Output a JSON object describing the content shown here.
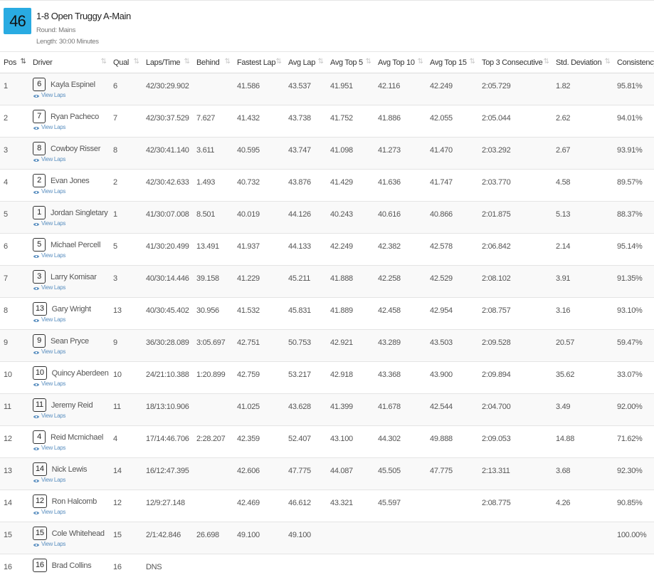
{
  "event": {
    "number": "46",
    "title": "1-8 Open Truggy A-Main",
    "round": "Round: Mains",
    "length": "Length: 30:00 Minutes"
  },
  "columns": [
    "Pos",
    "Driver",
    "Qual",
    "Laps/Time",
    "Behind",
    "Fastest Lap",
    "Avg Lap",
    "Avg Top 5",
    "Avg Top 10",
    "Avg Top 15",
    "Top 3 Consecutive",
    "Std. Deviation",
    "Consistency"
  ],
  "view_laps_label": "View Laps",
  "rows": [
    {
      "pos": "1",
      "car": "6",
      "driver": "Kayla Espinel",
      "qual": "6",
      "laps": "42/30:29.902",
      "behind": "",
      "fastest": "41.586",
      "avg": "43.537",
      "top5": "41.951",
      "top10": "42.116",
      "top15": "42.249",
      "top3c": "2:05.729",
      "std": "1.82",
      "cons": "95.81%",
      "view": true
    },
    {
      "pos": "2",
      "car": "7",
      "driver": "Ryan Pacheco",
      "qual": "7",
      "laps": "42/30:37.529",
      "behind": "7.627",
      "fastest": "41.432",
      "avg": "43.738",
      "top5": "41.752",
      "top10": "41.886",
      "top15": "42.055",
      "top3c": "2:05.044",
      "std": "2.62",
      "cons": "94.01%",
      "view": true
    },
    {
      "pos": "3",
      "car": "8",
      "driver": "Cowboy Risser",
      "qual": "8",
      "laps": "42/30:41.140",
      "behind": "3.611",
      "fastest": "40.595",
      "avg": "43.747",
      "top5": "41.098",
      "top10": "41.273",
      "top15": "41.470",
      "top3c": "2:03.292",
      "std": "2.67",
      "cons": "93.91%",
      "view": true
    },
    {
      "pos": "4",
      "car": "2",
      "driver": "Evan Jones",
      "qual": "2",
      "laps": "42/30:42.633",
      "behind": "1.493",
      "fastest": "40.732",
      "avg": "43.876",
      "top5": "41.429",
      "top10": "41.636",
      "top15": "41.747",
      "top3c": "2:03.770",
      "std": "4.58",
      "cons": "89.57%",
      "view": true
    },
    {
      "pos": "5",
      "car": "1",
      "driver": "Jordan Singletary",
      "qual": "1",
      "laps": "41/30:07.008",
      "behind": "8.501",
      "fastest": "40.019",
      "avg": "44.126",
      "top5": "40.243",
      "top10": "40.616",
      "top15": "40.866",
      "top3c": "2:01.875",
      "std": "5.13",
      "cons": "88.37%",
      "view": true
    },
    {
      "pos": "6",
      "car": "5",
      "driver": "Michael Percell",
      "qual": "5",
      "laps": "41/30:20.499",
      "behind": "13.491",
      "fastest": "41.937",
      "avg": "44.133",
      "top5": "42.249",
      "top10": "42.382",
      "top15": "42.578",
      "top3c": "2:06.842",
      "std": "2.14",
      "cons": "95.14%",
      "view": true
    },
    {
      "pos": "7",
      "car": "3",
      "driver": "Larry Komisar",
      "qual": "3",
      "laps": "40/30:14.446",
      "behind": "39.158",
      "fastest": "41.229",
      "avg": "45.211",
      "top5": "41.888",
      "top10": "42.258",
      "top15": "42.529",
      "top3c": "2:08.102",
      "std": "3.91",
      "cons": "91.35%",
      "view": true
    },
    {
      "pos": "8",
      "car": "13",
      "driver": "Gary Wright",
      "qual": "13",
      "laps": "40/30:45.402",
      "behind": "30.956",
      "fastest": "41.532",
      "avg": "45.831",
      "top5": "41.889",
      "top10": "42.458",
      "top15": "42.954",
      "top3c": "2:08.757",
      "std": "3.16",
      "cons": "93.10%",
      "view": true
    },
    {
      "pos": "9",
      "car": "9",
      "driver": "Sean Pryce",
      "qual": "9",
      "laps": "36/30:28.089",
      "behind": "3:05.697",
      "fastest": "42.751",
      "avg": "50.753",
      "top5": "42.921",
      "top10": "43.289",
      "top15": "43.503",
      "top3c": "2:09.528",
      "std": "20.57",
      "cons": "59.47%",
      "view": true
    },
    {
      "pos": "10",
      "car": "10",
      "driver": "Quincy Aberdeen",
      "qual": "10",
      "laps": "24/21:10.388",
      "behind": "1:20.899",
      "fastest": "42.759",
      "avg": "53.217",
      "top5": "42.918",
      "top10": "43.368",
      "top15": "43.900",
      "top3c": "2:09.894",
      "std": "35.62",
      "cons": "33.07%",
      "view": true
    },
    {
      "pos": "11",
      "car": "11",
      "driver": "Jeremy Reid",
      "qual": "11",
      "laps": "18/13:10.906",
      "behind": "",
      "fastest": "41.025",
      "avg": "43.628",
      "top5": "41.399",
      "top10": "41.678",
      "top15": "42.544",
      "top3c": "2:04.700",
      "std": "3.49",
      "cons": "92.00%",
      "view": true
    },
    {
      "pos": "12",
      "car": "4",
      "driver": "Reid Mcmichael",
      "qual": "4",
      "laps": "17/14:46.706",
      "behind": "2:28.207",
      "fastest": "42.359",
      "avg": "52.407",
      "top5": "43.100",
      "top10": "44.302",
      "top15": "49.888",
      "top3c": "2:09.053",
      "std": "14.88",
      "cons": "71.62%",
      "view": true
    },
    {
      "pos": "13",
      "car": "14",
      "driver": "Nick Lewis",
      "qual": "14",
      "laps": "16/12:47.395",
      "behind": "",
      "fastest": "42.606",
      "avg": "47.775",
      "top5": "44.087",
      "top10": "45.505",
      "top15": "47.775",
      "top3c": "2:13.311",
      "std": "3.68",
      "cons": "92.30%",
      "view": true
    },
    {
      "pos": "14",
      "car": "12",
      "driver": "Ron Halcomb",
      "qual": "12",
      "laps": "12/9:27.148",
      "behind": "",
      "fastest": "42.469",
      "avg": "46.612",
      "top5": "43.321",
      "top10": "45.597",
      "top15": "",
      "top3c": "2:08.775",
      "std": "4.26",
      "cons": "90.85%",
      "view": true
    },
    {
      "pos": "15",
      "car": "15",
      "driver": "Cole Whitehead",
      "qual": "15",
      "laps": "2/1:42.846",
      "behind": "26.698",
      "fastest": "49.100",
      "avg": "49.100",
      "top5": "",
      "top10": "",
      "top15": "",
      "top3c": "",
      "std": "",
      "cons": "100.00%",
      "view": true
    },
    {
      "pos": "16",
      "car": "16",
      "driver": "Brad Collins",
      "qual": "16",
      "laps": "DNS",
      "behind": "",
      "fastest": "",
      "avg": "",
      "top5": "",
      "top10": "",
      "top15": "",
      "top3c": "",
      "std": "",
      "cons": "",
      "view": false
    }
  ]
}
